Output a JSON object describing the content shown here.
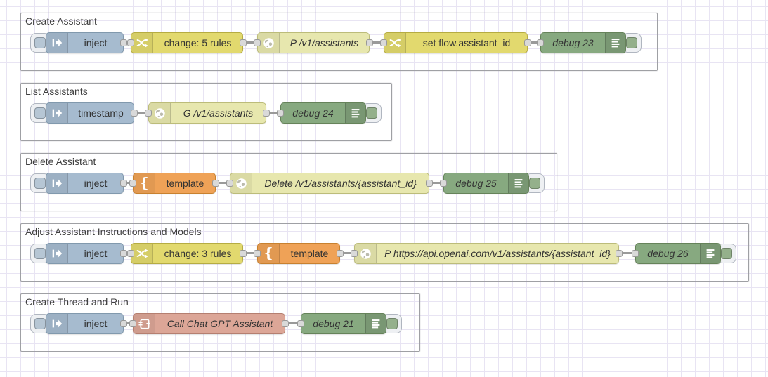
{
  "app": {
    "kind": "flow-editor-canvas"
  },
  "palette": {
    "canvas_bg": "#ffffff",
    "grid_line": "#e8e4f3",
    "group_border": "#9fa0a4",
    "node_inject": "#a6bbcf",
    "node_change": "#e2d96e",
    "node_http_request": "#e7e7ae",
    "node_template": "#efa257",
    "node_debug": "#87a980",
    "node_subflow": "#dca697",
    "wire": "#9a9a9a",
    "port_fill": "#d9d9d9",
    "port_border": "#999999",
    "label_color": "#333333"
  },
  "icons": {
    "template_brace": "{"
  },
  "groups": [
    {
      "title": "Create Assistant",
      "nodes": [
        {
          "type": "inject",
          "label": "inject"
        },
        {
          "type": "change",
          "label": "change: 5 rules"
        },
        {
          "type": "http-request",
          "label": "P /v1/assistants"
        },
        {
          "type": "change",
          "label": "set flow.assistant_id"
        },
        {
          "type": "debug",
          "label": "debug 23"
        }
      ]
    },
    {
      "title": "List Assistants",
      "nodes": [
        {
          "type": "inject",
          "label": "timestamp"
        },
        {
          "type": "http-request",
          "label": "G /v1/assistants"
        },
        {
          "type": "debug",
          "label": "debug 24"
        }
      ]
    },
    {
      "title": "Delete Assistant",
      "nodes": [
        {
          "type": "inject",
          "label": "inject"
        },
        {
          "type": "template",
          "label": "template"
        },
        {
          "type": "http-request",
          "label": "Delete /v1/assistants/{assistant_id}"
        },
        {
          "type": "debug",
          "label": "debug 25"
        }
      ]
    },
    {
      "title": "Adjust Assistant Instructions and Models",
      "nodes": [
        {
          "type": "inject",
          "label": "inject"
        },
        {
          "type": "change",
          "label": "change: 3 rules"
        },
        {
          "type": "template",
          "label": "template"
        },
        {
          "type": "http-request",
          "label": "P https://api.openai.com/v1/assistants/{assistant_id}"
        },
        {
          "type": "debug",
          "label": "debug 26"
        }
      ]
    },
    {
      "title": "Create Thread and Run",
      "nodes": [
        {
          "type": "inject",
          "label": "inject"
        },
        {
          "type": "subflow",
          "label": "Call Chat GPT Assistant"
        },
        {
          "type": "debug",
          "label": "debug 21"
        }
      ]
    }
  ]
}
